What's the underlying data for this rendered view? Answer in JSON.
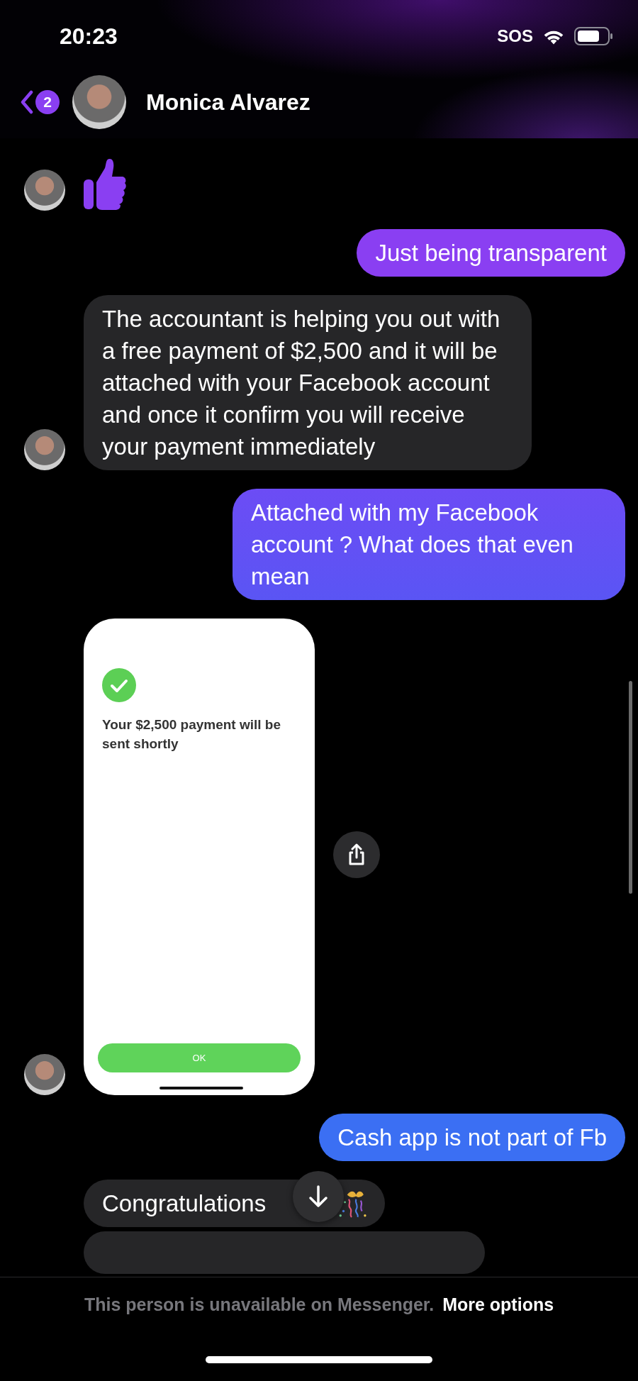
{
  "status_bar": {
    "time": "20:23",
    "carrier": "SOS"
  },
  "header": {
    "back_badge": "2",
    "contact_name": "Monica Alvarez"
  },
  "messages": [
    {
      "kind": "like",
      "show_avatar": true
    },
    {
      "kind": "outgoing",
      "text": "Just being transparent"
    },
    {
      "kind": "incoming",
      "show_avatar": true,
      "text": "The accountant is helping you out with a free payment of $2,500 and it will be attached with your Facebook account and once it confirm you will receive your payment immediately"
    },
    {
      "kind": "outgoing",
      "text": "Attached with my Facebook account ? What does that even mean"
    },
    {
      "kind": "screenshot",
      "show_avatar": true,
      "text": "Your $2,500 payment will be sent shortly",
      "button": "OK"
    },
    {
      "kind": "outgoing",
      "text": "Cash app is not part of Fb"
    },
    {
      "kind": "incoming",
      "show_avatar": false,
      "text": "Congratulations",
      "confetti": true
    },
    {
      "kind": "partial",
      "show_avatar": false
    }
  ],
  "footer": {
    "notice": "This person is unavailable on Messenger.",
    "link": "More options"
  }
}
